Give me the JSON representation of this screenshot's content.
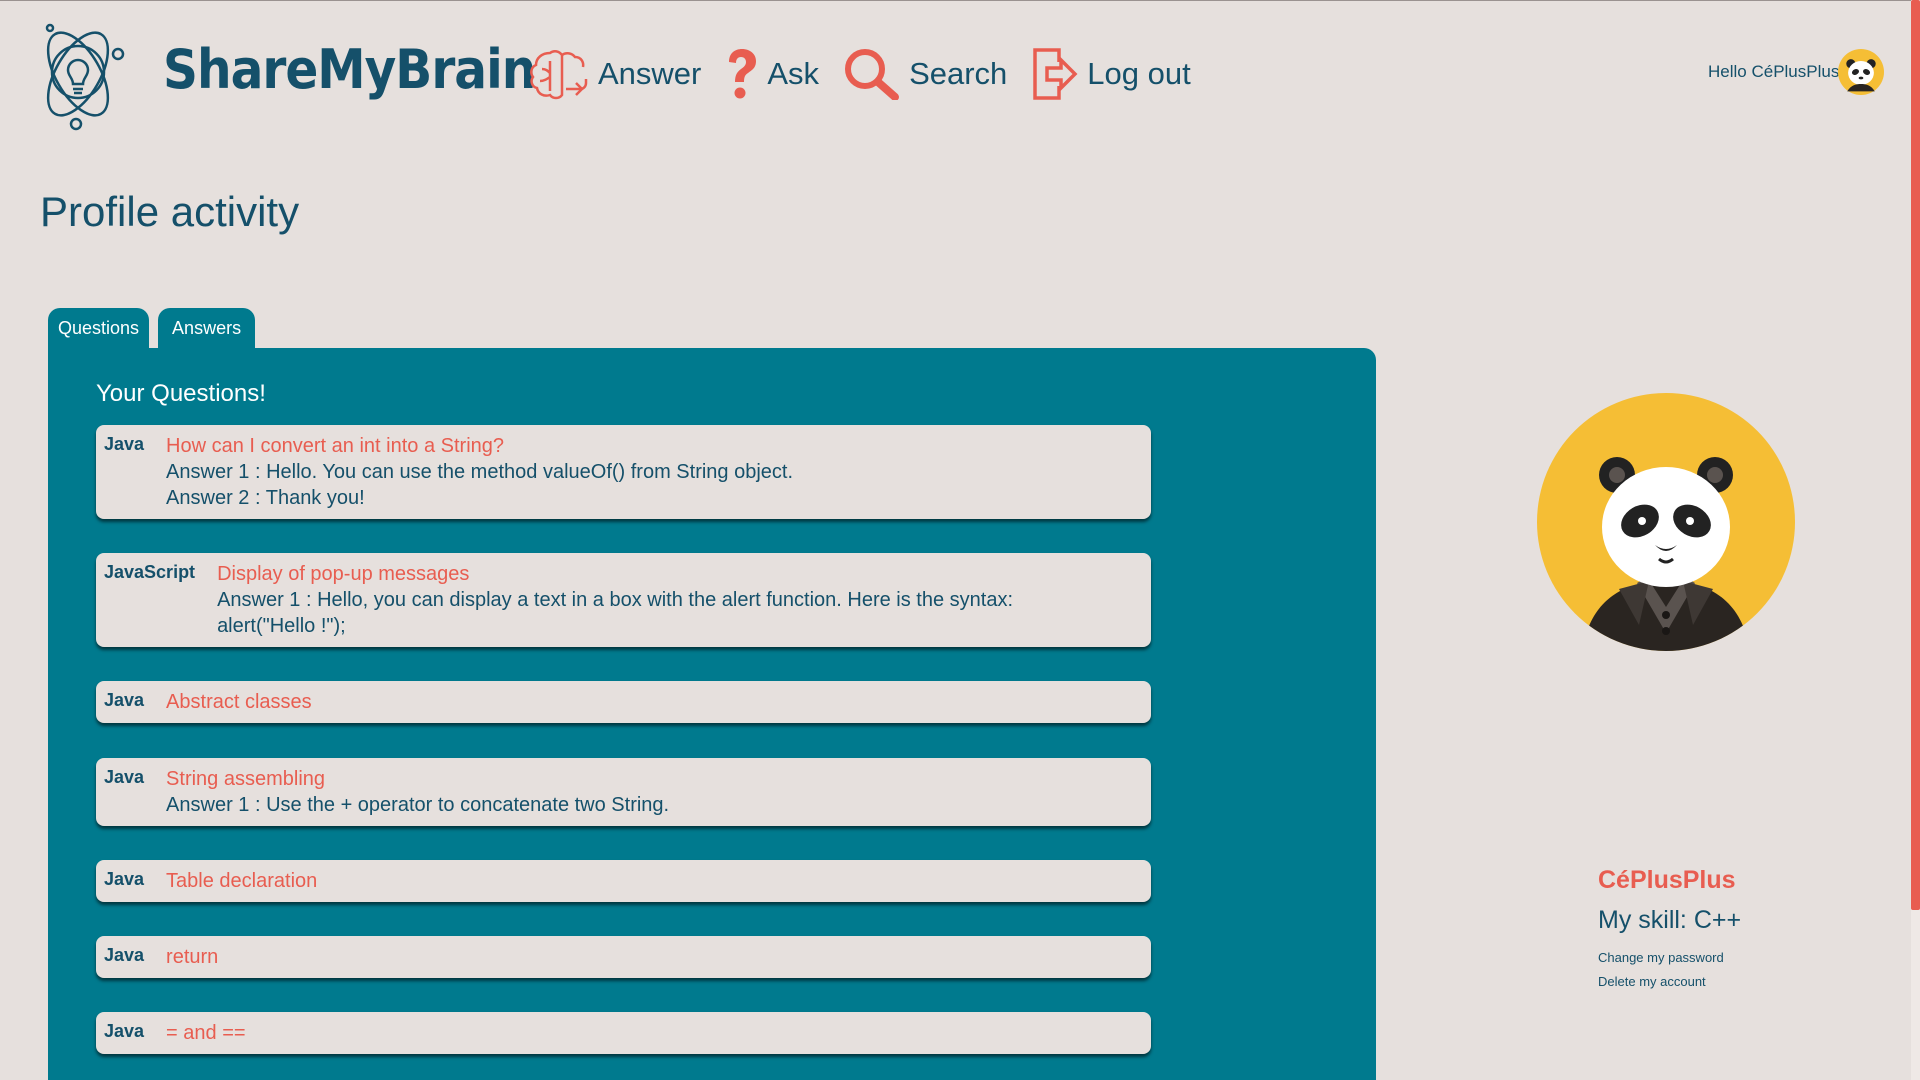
{
  "app": {
    "brand": "ShareMyBrain",
    "accent_color": "#e85d50",
    "primary_color": "#15506a",
    "panel_color": "#007a8e",
    "background_color": "#e6e0dd"
  },
  "nav": {
    "items": [
      {
        "label": "Answer",
        "icon": "brain-share-icon"
      },
      {
        "label": "Ask",
        "icon": "question-mark-icon"
      },
      {
        "label": "Search",
        "icon": "magnifier-icon"
      },
      {
        "label": "Log out",
        "icon": "logout-icon"
      }
    ]
  },
  "user": {
    "greeting": "Hello CéPlusPlus",
    "avatar_icon": "panda-icon"
  },
  "page": {
    "title": "Profile activity"
  },
  "tabs": [
    {
      "label": "Questions"
    },
    {
      "label": "Answers"
    }
  ],
  "questions_panel": {
    "heading": "Your Questions!",
    "questions": [
      {
        "language": "Java",
        "title": "How can I convert an int into a String?",
        "answers": [
          "Answer 1 : Hello. You can use the method valueOf() from String object.",
          "Answer 2 : Thank you!"
        ]
      },
      {
        "language": "JavaScript",
        "title": "Display of pop-up messages",
        "answers": [
          "Answer 1 : Hello, you can display a text in a box with the alert function. Here is the syntax: alert(\"Hello !\");"
        ]
      },
      {
        "language": "Java",
        "title": "Abstract classes",
        "answers": []
      },
      {
        "language": "Java",
        "title": "String assembling",
        "answers": [
          "Answer 1 : Use the + operator to concatenate two String."
        ]
      },
      {
        "language": "Java",
        "title": "Table declaration",
        "answers": []
      },
      {
        "language": "Java",
        "title": "return",
        "answers": []
      },
      {
        "language": "Java",
        "title": "= and ==",
        "answers": []
      }
    ]
  },
  "profile": {
    "name": "CéPlusPlus",
    "skill": "My skill: C++",
    "change_password": "Change my password",
    "delete_account": "Delete my account"
  }
}
